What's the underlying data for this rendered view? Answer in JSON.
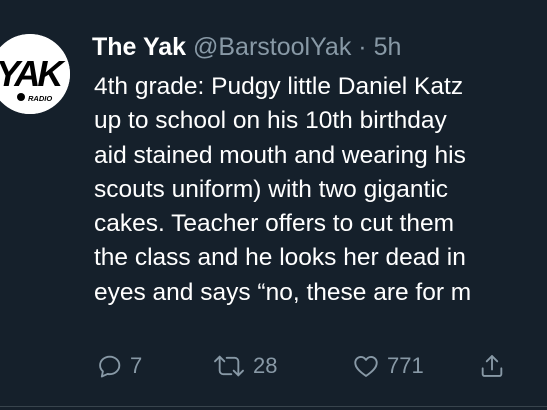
{
  "tweet": {
    "display_name": "The Yak",
    "handle": "@BarstoolYak",
    "separator": "·",
    "time": "5h",
    "avatar": {
      "logo_text": "YAK",
      "sub_text": "RADIO"
    },
    "body_lines": [
      "4th grade: Pudgy little Daniel Katz",
      "up to school on his 10th birthday",
      "aid stained mouth and wearing his",
      "scouts uniform) with two gigantic",
      "cakes. Teacher offers to cut them",
      "the class and he looks her dead in",
      "eyes and says “no, these are for m"
    ],
    "actions": {
      "reply_count": "7",
      "retweet_count": "28",
      "like_count": "771"
    }
  },
  "colors": {
    "background": "#15202b",
    "text_primary": "#ffffff",
    "text_secondary": "#8899a6"
  },
  "icons": [
    "reply-icon",
    "retweet-icon",
    "like-icon",
    "share-icon"
  ]
}
